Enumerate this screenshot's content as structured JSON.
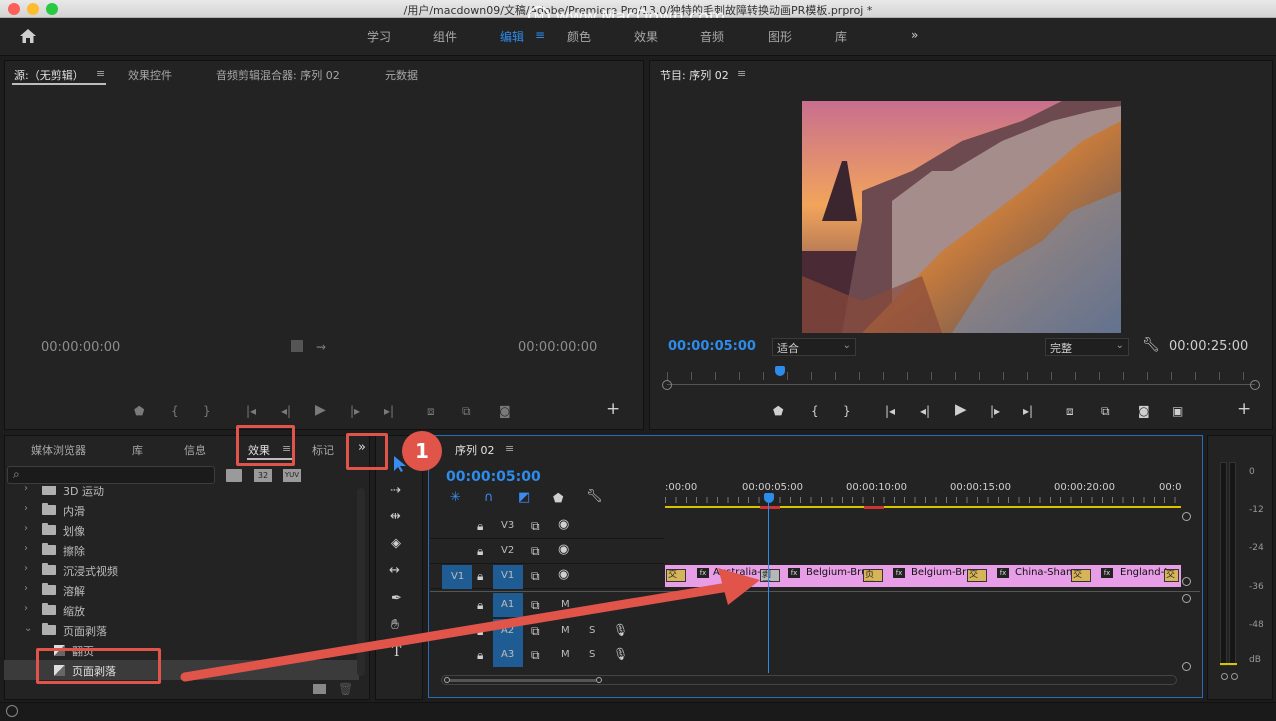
{
  "window": {
    "title": "/用户/macdown09/文稿/Adobe/Premiere Pro/13.0/独特的毛刺故障转换动画PR模板.prproj *",
    "watermark": "www.MacDown.com"
  },
  "workspaces": {
    "items": [
      "学习",
      "组件",
      "编辑",
      "颜色",
      "效果",
      "音频",
      "图形",
      "库"
    ],
    "active": "编辑",
    "more": "»"
  },
  "source_panel": {
    "tabs": [
      "源:（无剪辑）",
      "效果控件",
      "音频剪辑混合器: 序列 02",
      "元数据"
    ],
    "menu": "≡",
    "timecode_left": "00:00:00:00",
    "timecode_right": "00:00:00:00"
  },
  "program_panel": {
    "title": "节目: 序列 02",
    "menu": "≡",
    "timecode": "00:00:05:00",
    "fit": "适合",
    "quality": "完整",
    "duration": "00:00:25:00"
  },
  "project_panel": {
    "tabs": [
      "媒体浏览器",
      "库",
      "信息",
      "效果",
      "标记"
    ],
    "active": "效果",
    "menu": "≡",
    "more": "»",
    "search_placeholder": "",
    "badges": [
      "32",
      "YUV"
    ],
    "tree": [
      {
        "label": "3D 运动",
        "kind": "folder",
        "expanded": false
      },
      {
        "label": "内滑",
        "kind": "folder",
        "expanded": false
      },
      {
        "label": "划像",
        "kind": "folder",
        "expanded": false
      },
      {
        "label": "擦除",
        "kind": "folder",
        "expanded": false
      },
      {
        "label": "沉浸式视频",
        "kind": "folder",
        "expanded": false
      },
      {
        "label": "溶解",
        "kind": "folder",
        "expanded": false
      },
      {
        "label": "缩放",
        "kind": "folder",
        "expanded": false
      },
      {
        "label": "页面剥落",
        "kind": "folder",
        "expanded": true
      },
      {
        "label": "翻页",
        "kind": "effect"
      },
      {
        "label": "页面剥落",
        "kind": "effect",
        "selected": true
      }
    ]
  },
  "timeline": {
    "title": "序列 02",
    "menu": "≡",
    "close": "×",
    "timecode": "00:00:05:00",
    "ruler": [
      ":00:00",
      "00:00:05:00",
      "00:00:10:00",
      "00:00:15:00",
      "00:00:20:00",
      "00:0"
    ],
    "tracks": {
      "video": [
        "V3",
        "V2",
        "V1"
      ],
      "audio": [
        "A1",
        "A2",
        "A3"
      ],
      "source_video": "V1",
      "source_audio": "A1",
      "mute": "M",
      "solo": "S"
    },
    "clips": [
      "Australia-",
      "Belgium-Brug",
      "Belgium-Bru",
      "China-Shang",
      "England-L"
    ],
    "transitions": [
      "交叉",
      "剥页",
      "页面",
      "交叉",
      "交叉",
      "交"
    ],
    "fx_label": "fx"
  },
  "meters": {
    "scale": [
      "0",
      "-12",
      "-24",
      "-36",
      "-48",
      "dB"
    ]
  },
  "annotation": {
    "step": "1",
    "color": "#e0544a"
  },
  "colors": {
    "accent": "#2d8ceb",
    "clip": "#e79ee6",
    "highlight": "#e0544a"
  }
}
